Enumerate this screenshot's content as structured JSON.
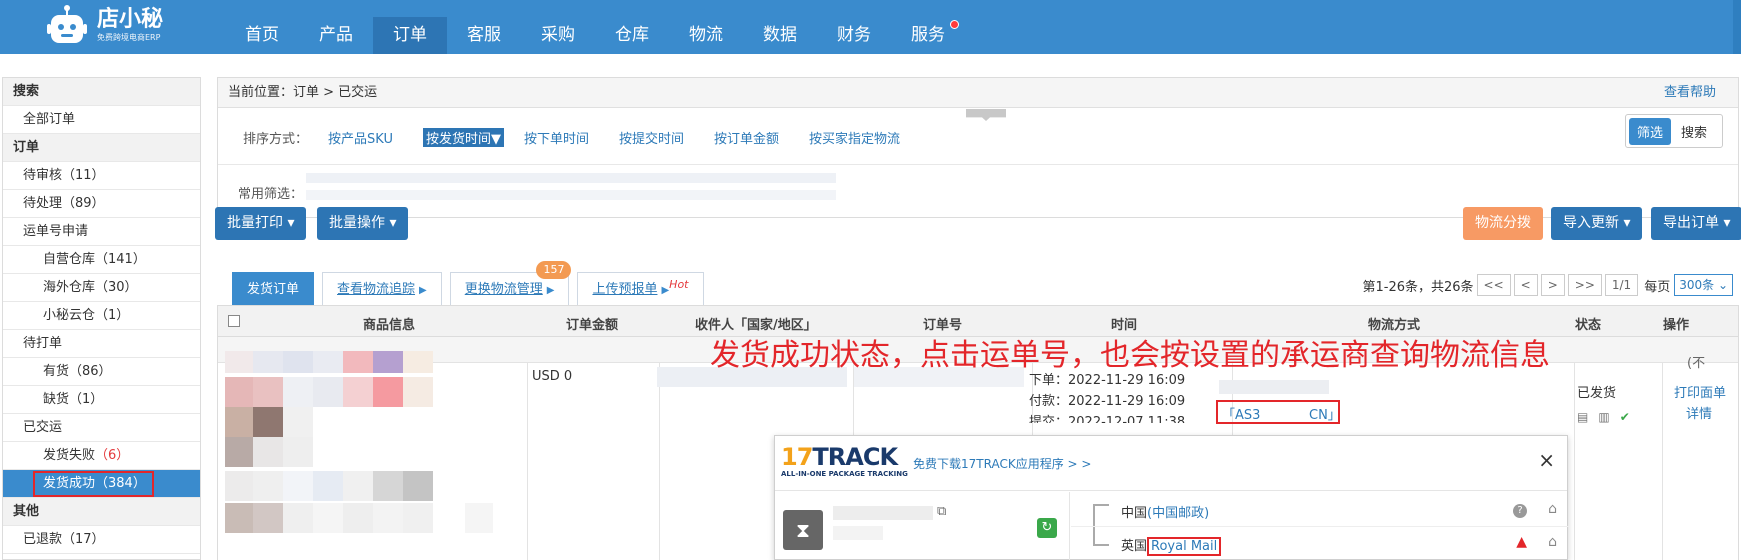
{
  "header": {
    "brand_name": "店小秘",
    "brand_sub": "免费跨境电商ERP",
    "nav": [
      "首页",
      "产品",
      "订单",
      "客服",
      "采购",
      "仓库",
      "物流",
      "数据",
      "财务",
      "服务"
    ]
  },
  "sidebar": {
    "items": [
      {
        "label": "搜索",
        "type": "head"
      },
      {
        "label": "全部订单",
        "type": "item"
      },
      {
        "label": "订单",
        "type": "head"
      },
      {
        "label": "待审核",
        "count": "（11）",
        "type": "item"
      },
      {
        "label": "待处理",
        "count": "（89）",
        "type": "item"
      },
      {
        "label": "运单号申请",
        "type": "item"
      },
      {
        "label": "自营仓库",
        "count": "（141）",
        "type": "sub"
      },
      {
        "label": "海外仓库",
        "count": "（30）",
        "type": "sub"
      },
      {
        "label": "小秘云仓",
        "count": "（1）",
        "type": "sub"
      },
      {
        "label": "待打单",
        "type": "item"
      },
      {
        "label": "有货",
        "count": "（86）",
        "type": "sub"
      },
      {
        "label": "缺货",
        "count": "（1）",
        "type": "sub"
      },
      {
        "label": "已交运",
        "type": "item"
      },
      {
        "label": "发货失败",
        "count": "（6）",
        "type": "sub"
      },
      {
        "label": "发货成功",
        "count": "（384）",
        "type": "sub"
      },
      {
        "label": "其他",
        "type": "head"
      },
      {
        "label": "已退款",
        "count": "（17）",
        "type": "item"
      }
    ]
  },
  "breadcrumb": {
    "label": "当前位置：",
    "path": "订单 > 已交运",
    "help": "查看帮助"
  },
  "sort": {
    "label": "排序方式：",
    "options": [
      "按产品SKU",
      "按发货时间",
      "按下单时间",
      "按提交时间",
      "按订单金额",
      "按买家指定物流"
    ],
    "selected_suffix": "▼"
  },
  "toggle": {
    "on": "筛选",
    "off": "搜索"
  },
  "filter": {
    "label": "常用筛选："
  },
  "actions": {
    "batch_print": "批量打印 ▾",
    "batch_ops": "批量操作 ▾",
    "logistics_split": "物流分拨",
    "import_update": "导入更新 ▾",
    "export_orders": "导出订单 ▾"
  },
  "tabs": {
    "ship_orders": "发货订单",
    "track": "查看物流追踪",
    "change": "更换物流管理",
    "change_badge": "157",
    "upload": "上传预报单",
    "hot": "Hot"
  },
  "pager": {
    "summary": "第1-26条，共26条",
    "first": "<<",
    "prev": "<",
    "next": ">",
    "last": ">>",
    "page": "1/1",
    "per_page_label": "每页",
    "per_page": "300条"
  },
  "table": {
    "headers": [
      "商品信息",
      "订单金额",
      "收件人「国家/地区」",
      "订单号",
      "时间",
      "物流方式",
      "状态",
      "操作"
    ],
    "row": {
      "amount": "USD 0",
      "order_time": "下单：2022-11-29 16:09",
      "pay_time": "付款：2022-11-29 16:09",
      "submit_time": "提交：2022-12-07 11:38",
      "tracking_left": "「AS3",
      "tracking_right": "CN」",
      "status": "已发货",
      "op_print": "打印面单",
      "op_detail": "详情",
      "extra": "(不"
    }
  },
  "annotation": "发货成功状态，点击运单号，也会按设置的承运商查询物流信息",
  "popup": {
    "logo_num": "17",
    "logo_word": "TRACK",
    "logo_sub": "ALL-IN-ONE PACKAGE TRACKING",
    "download": "免费下载17TRACK应用程序 > >",
    "close": "×",
    "origin_country": "中国",
    "origin_carrier": "(中国邮政)",
    "dest_country": "英国",
    "dest_carrier": "Royal Mail"
  },
  "colors": {
    "nav_bg": "#3a8bcd",
    "accent": "#2d75b4",
    "red": "#e3262a",
    "orange": "#f79a64"
  }
}
